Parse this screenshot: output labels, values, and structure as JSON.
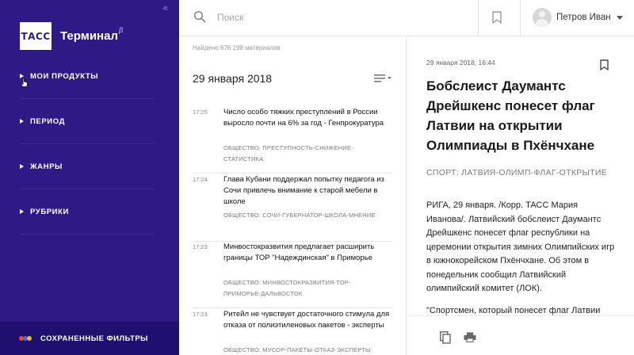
{
  "sidebar": {
    "collapse_glyph": "«",
    "logo": {
      "mark": "ТАСС",
      "title": "Терминал",
      "beta": "β"
    },
    "items": [
      {
        "label": "МОИ ПРОДУКТЫ",
        "icon": "triangle-right-icon"
      },
      {
        "label": "ПЕРИОД",
        "icon": "triangle-right-icon"
      },
      {
        "label": "ЖАНРЫ",
        "icon": "triangle-right-icon"
      },
      {
        "label": "РУБРИКИ",
        "icon": "triangle-right-icon"
      }
    ],
    "saved_filters": {
      "label": "СОХРАНЕННЫЕ ФИЛЬТРЫ",
      "dot_colors": [
        "#e8493a",
        "#3b6ff0",
        "#f2b12c"
      ]
    },
    "background": "#2e1a87"
  },
  "topbar": {
    "search": {
      "placeholder": "Поиск",
      "value": ""
    },
    "user": {
      "name": "Петров Иван"
    }
  },
  "feed": {
    "found_text": "Найдено 676 198 материалов",
    "date": "29 января 2018",
    "items": [
      {
        "time": "17:25",
        "title": "Число особо тяжких преступлений в России выросло почти на 6% за год - Генпрокуратура",
        "tags": "ОБЩЕСТВО: ПРЕСТУПНОСТЬ-СНИЖЕНИЕ-СТАТИСТИКА"
      },
      {
        "time": "17:24",
        "title": "Глава Кубани поддержал попытку педагога из Сочи привлечь внимание к старой мебели в школе",
        "tags": "ОБЩЕСТВО: СОЧИ-ГУБЕРНАТОР-ШКОЛА-МНЕНИЕ"
      },
      {
        "time": "17:23",
        "title": "Минвостокразвития предлагает расширить границы ТОР \"Надеждинская\" в Приморье",
        "tags": "ОБЩЕСТВО: МИНВОСТОКРАЗВИТИЯ-ТОР-ПРИМОРЬЕ-ДАЛЬВОСТОК"
      },
      {
        "time": "17:23",
        "title": "Ритейл не чувствует достаточного стимула для отказа от полиэтиленовых пакетов - эксперты",
        "tags": "ОБЩЕСТВО: МУСОР-ПАКЕТЫ-ОТКАЗ-ЭКСПЕРТЫ"
      }
    ]
  },
  "article": {
    "datetime": "29 января 2018, 16:44",
    "title": "Бобслеист Даумантс Дрейшкенс понесет флаг Латвии на открытии Олимпиады в Пхёнчхане",
    "tags": "СПОРТ: ЛАТВИЯ-ОЛИМП-ФЛАГ-ОТКРЫТИЕ",
    "body": "РИГА, 29 января. /Корр. ТАСС Мария Иванова/. Латвийский бобслеист Даумантс Дрейшкенс понесет флаг республики на церемонии открытия зимних Олимпийских игр в южнокорейском Пхёнчхане. Об этом в понедельник сообщил Латвийский олимпийский комитет (ЛОК).",
    "quote": "\"Спортсмен, который понесет флаг Латвии"
  }
}
